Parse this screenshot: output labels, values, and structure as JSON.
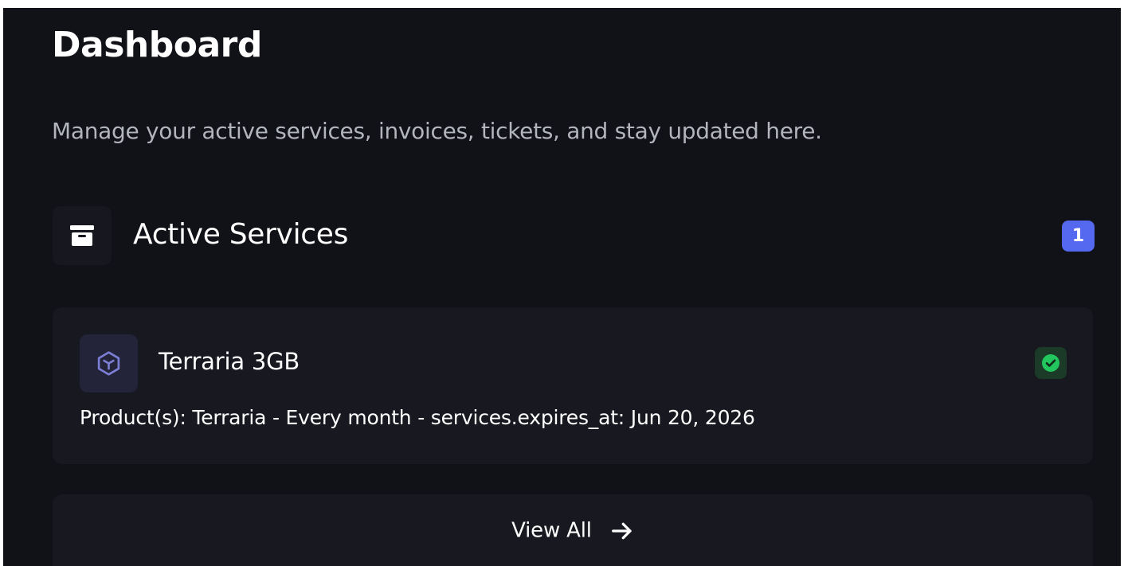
{
  "header": {
    "title": "Dashboard",
    "subtitle": "Manage your active services, invoices, tickets, and stay updated here."
  },
  "active_services": {
    "icon": "archive-box-icon",
    "title": "Active Services",
    "count": "1",
    "items": [
      {
        "icon": "cube-icon",
        "name": "Terraria 3GB",
        "status_icon": "check-circle-icon",
        "status_color": "#22c55e",
        "details": "Product(s): Terraria - Every month - services.expires_at: Jun 20, 2026"
      }
    ],
    "view_all_label": "View All",
    "view_all_icon": "arrow-right-icon"
  },
  "colors": {
    "background": "#111118",
    "card": "#181920",
    "accent": "#5468f0",
    "success": "#22c55e"
  }
}
